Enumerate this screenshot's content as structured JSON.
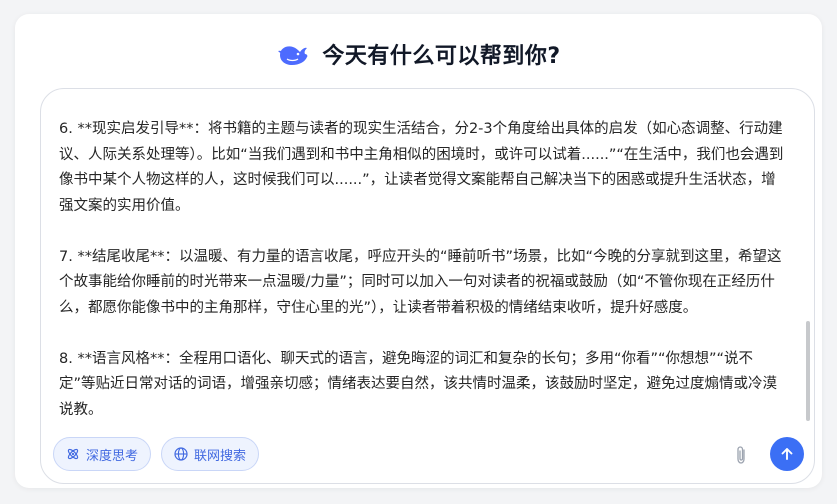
{
  "header": {
    "title": "今天有什么可以帮到你?",
    "logo_icon": "whale-logo-icon"
  },
  "conversation": {
    "paragraphs": [
      "6. **现实启发引导**：将书籍的主题与读者的现实生活结合，分2-3个角度给出具体的启发（如心态调整、行动建议、人际关系处理等）。比如“当我们遇到和书中主角相似的困境时，或许可以试着......”“在生活中，我们也会遇到像书中某个人物这样的人，这时候我们可以......”，让读者觉得文案能帮自己解决当下的困惑或提升生活状态，增强文案的实用价值。",
      "7. **结尾收尾**：以温暖、有力量的语言收尾，呼应开头的“睡前听书”场景，比如“今晚的分享就到这里，希望这个故事能给你睡前的时光带来一点温暖/力量”；同时可以加入一句对读者的祝福或鼓励（如“不管你现在正经历什么，都愿你能像书中的主角那样，守住心里的光”），让读者带着积极的情绪结束收听，提升好感度。",
      "8. **语言风格**：全程用口语化、聊天式的语言，避免晦涩的词汇和复杂的长句；多用“你看”“你想想”“说不定”等贴近日常对话的词语，增强亲切感；情绪表达要自然，该共情时温柔，该鼓励时坚定，避免过度煽情或冷漠说教。"
    ]
  },
  "toolbar": {
    "deep_think_label": "深度思考",
    "deep_think_icon": "atom-icon",
    "web_search_label": "联网搜索",
    "web_search_icon": "globe-icon",
    "attach_icon": "paperclip-icon",
    "send_icon": "arrow-up-icon"
  },
  "colors": {
    "accent": "#3b6ff5",
    "pill_bg": "#eef3fe",
    "pill_text": "#4169e1",
    "logo": "#4d6bfe"
  }
}
